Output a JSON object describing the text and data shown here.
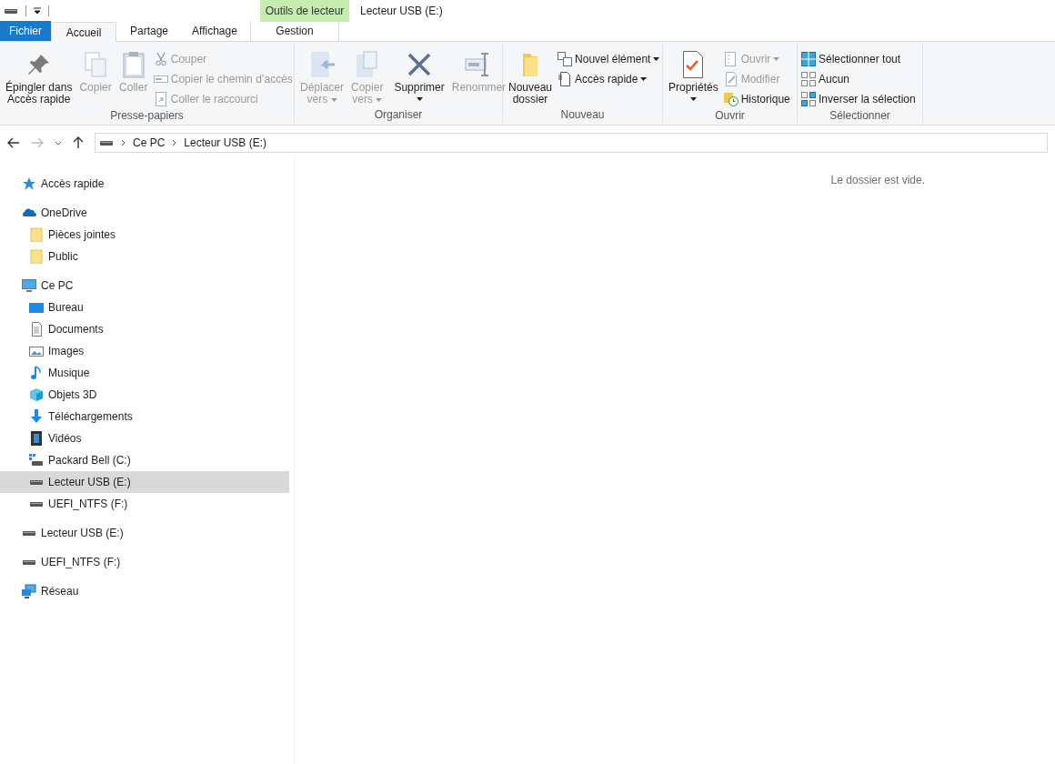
{
  "title_bar": {
    "context_tab_group": "Outils de lecteur",
    "title": "Lecteur USB (E:)"
  },
  "tabs": [
    {
      "label": "Fichier",
      "kind": "file",
      "selected": false
    },
    {
      "label": "Accueil",
      "kind": "normal",
      "selected": true
    },
    {
      "label": "Partage",
      "kind": "normal",
      "selected": false
    },
    {
      "label": "Affichage",
      "kind": "normal",
      "selected": false
    },
    {
      "label": "Gestion",
      "kind": "context",
      "selected": false
    }
  ],
  "ribbon": {
    "groups": [
      {
        "name": "Presse-papiers",
        "columns": [
          [
            {
              "label": "Épingler dans\nAccès rapide",
              "kind": "large",
              "disabled": false,
              "dropdown": false
            }
          ],
          [
            {
              "label": "Copier",
              "kind": "large",
              "disabled": true,
              "dropdown": false
            }
          ],
          [
            {
              "label": "Coller",
              "kind": "large",
              "disabled": true,
              "dropdown": false
            }
          ],
          [
            {
              "label": "Couper",
              "kind": "small",
              "disabled": true,
              "dropdown": false
            },
            {
              "label": "Copier le chemin d’accès",
              "kind": "small",
              "disabled": true,
              "dropdown": false
            },
            {
              "label": "Coller le raccourci",
              "kind": "small",
              "disabled": true,
              "dropdown": false
            }
          ]
        ]
      },
      {
        "name": "Organiser",
        "columns": [
          [
            {
              "label": "Déplacer\nvers",
              "kind": "large",
              "disabled": true,
              "dropdown": true
            }
          ],
          [
            {
              "label": "Copier\nvers",
              "kind": "large",
              "disabled": true,
              "dropdown": true
            }
          ],
          [
            {
              "label": "Supprimer",
              "kind": "large",
              "disabled": false,
              "dropdown": true
            }
          ],
          [
            {
              "label": "Renommer",
              "kind": "large",
              "disabled": true,
              "dropdown": false
            }
          ]
        ]
      },
      {
        "name": "Nouveau",
        "columns": [
          [
            {
              "label": "Nouveau\ndossier",
              "kind": "large",
              "disabled": false,
              "dropdown": false
            }
          ],
          [
            {
              "label": "Nouvel élément",
              "kind": "small",
              "disabled": false,
              "dropdown": true
            },
            {
              "label": "Accès rapide",
              "kind": "small",
              "disabled": false,
              "dropdown": true
            }
          ]
        ]
      },
      {
        "name": "Ouvrir",
        "columns": [
          [
            {
              "label": "Propriétés",
              "kind": "large",
              "disabled": false,
              "dropdown": true
            }
          ],
          [
            {
              "label": "Ouvrir",
              "kind": "small",
              "disabled": true,
              "dropdown": true
            },
            {
              "label": "Modifier",
              "kind": "small",
              "disabled": true,
              "dropdown": false
            },
            {
              "label": "Historique",
              "kind": "small",
              "disabled": false,
              "dropdown": false
            }
          ]
        ]
      },
      {
        "name": "Sélectionner",
        "columns": [
          [
            {
              "label": "Sélectionner tout",
              "kind": "small",
              "disabled": false,
              "dropdown": false
            },
            {
              "label": "Aucun",
              "kind": "small",
              "disabled": false,
              "dropdown": false
            },
            {
              "label": "Inverser la sélection",
              "kind": "small",
              "disabled": false,
              "dropdown": false
            }
          ]
        ]
      }
    ]
  },
  "address_bar": {
    "breadcrumb": [
      "Ce PC",
      "Lecteur USB (E:)"
    ]
  },
  "sidebar": {
    "items": [
      {
        "label": "Accès rapide",
        "selected": false
      },
      {
        "label": "OneDrive",
        "selected": false,
        "children": [
          {
            "label": "Pièces jointes",
            "selected": false
          },
          {
            "label": "Public",
            "selected": false
          }
        ]
      },
      {
        "label": "Ce PC",
        "selected": false,
        "children": [
          {
            "label": "Bureau",
            "selected": false
          },
          {
            "label": "Documents",
            "selected": false
          },
          {
            "label": "Images",
            "selected": false
          },
          {
            "label": "Musique",
            "selected": false
          },
          {
            "label": "Objets 3D",
            "selected": false
          },
          {
            "label": "Téléchargements",
            "selected": false
          },
          {
            "label": "Vidéos",
            "selected": false
          },
          {
            "label": "Packard Bell (C:)",
            "selected": false
          },
          {
            "label": "Lecteur USB (E:)",
            "selected": true
          },
          {
            "label": "UEFI_NTFS (F:)",
            "selected": false
          }
        ]
      },
      {
        "label": "Lecteur USB (E:)",
        "selected": false
      },
      {
        "label": "UEFI_NTFS (F:)",
        "selected": false
      },
      {
        "label": "Réseau",
        "selected": false
      }
    ]
  },
  "content": {
    "empty_message": "Le dossier est vide."
  }
}
